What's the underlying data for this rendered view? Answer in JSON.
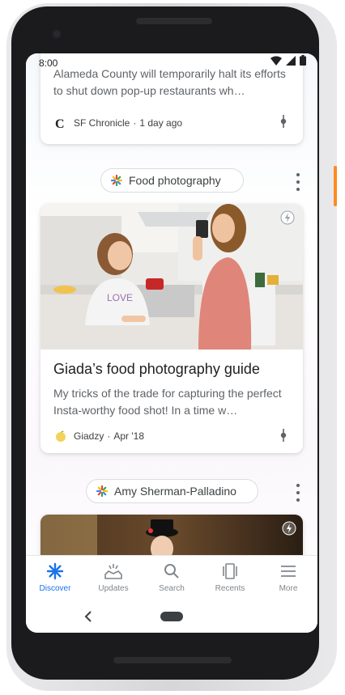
{
  "status_bar": {
    "time": "8:00"
  },
  "cards": [
    {
      "snippet": "Alameda County will temporarily halt its efforts to shut down pop-up restaurants wh…",
      "source": "SF Chronicle",
      "time": "1 day ago"
    },
    {
      "topic": "Food photography",
      "title": "Giada’s food photography guide",
      "snippet": "My tricks of the trade for capturing the perfect Insta-worthy food shot! In a time w…",
      "source": "Giadzy",
      "time": "Apr '18",
      "image_alt": "Mother and daughter cooking in a kitchen while mother takes a photo"
    },
    {
      "topic": "Amy Sherman-Palladino",
      "image_alt": "Woman in a black top hat at an awards event"
    }
  ],
  "bottom_nav": {
    "items": [
      {
        "label": "Discover",
        "icon": "asterisk-icon",
        "active": true
      },
      {
        "label": "Updates",
        "icon": "updates-icon",
        "active": false
      },
      {
        "label": "Search",
        "icon": "search-icon",
        "active": false
      },
      {
        "label": "Recents",
        "icon": "recents-icon",
        "active": false
      },
      {
        "label": "More",
        "icon": "menu-icon",
        "active": false
      }
    ]
  },
  "colors": {
    "accent": "#1a73e8",
    "phone_accent_button": "#ff8a1f"
  }
}
